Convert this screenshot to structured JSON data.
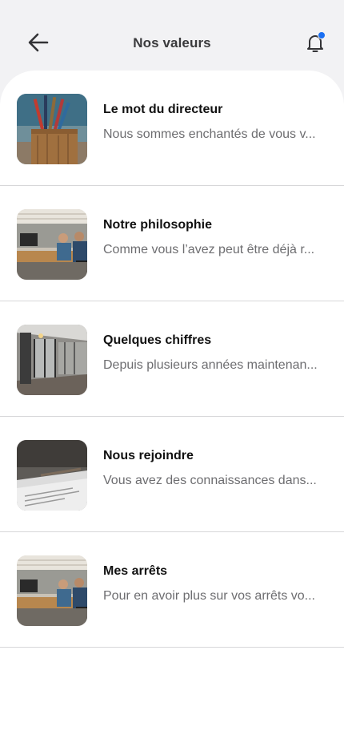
{
  "header": {
    "title": "Nos valeurs",
    "back_icon": "arrow-left-icon",
    "notification_icon": "bell-icon",
    "notification_dot_color": "#1a6ff2"
  },
  "items": [
    {
      "title": "Le mot du directeur",
      "subtitle": "Nous sommes enchantés de vous v...",
      "image": "pencil-cup-photo"
    },
    {
      "title": "Notre philosophie",
      "subtitle": "Comme vous l’avez peut être déjà r...",
      "image": "office-team-photo"
    },
    {
      "title": "Quelques chiffres",
      "subtitle": "Depuis plusieurs années maintenan...",
      "image": "office-corridor-photo"
    },
    {
      "title": "Nous rejoindre",
      "subtitle": "Vous avez des connaissances dans...",
      "image": "documents-photo"
    },
    {
      "title": "Mes arrêts",
      "subtitle": "Pour en avoir plus sur vos arrêts vo...",
      "image": "office-team-photo"
    }
  ]
}
